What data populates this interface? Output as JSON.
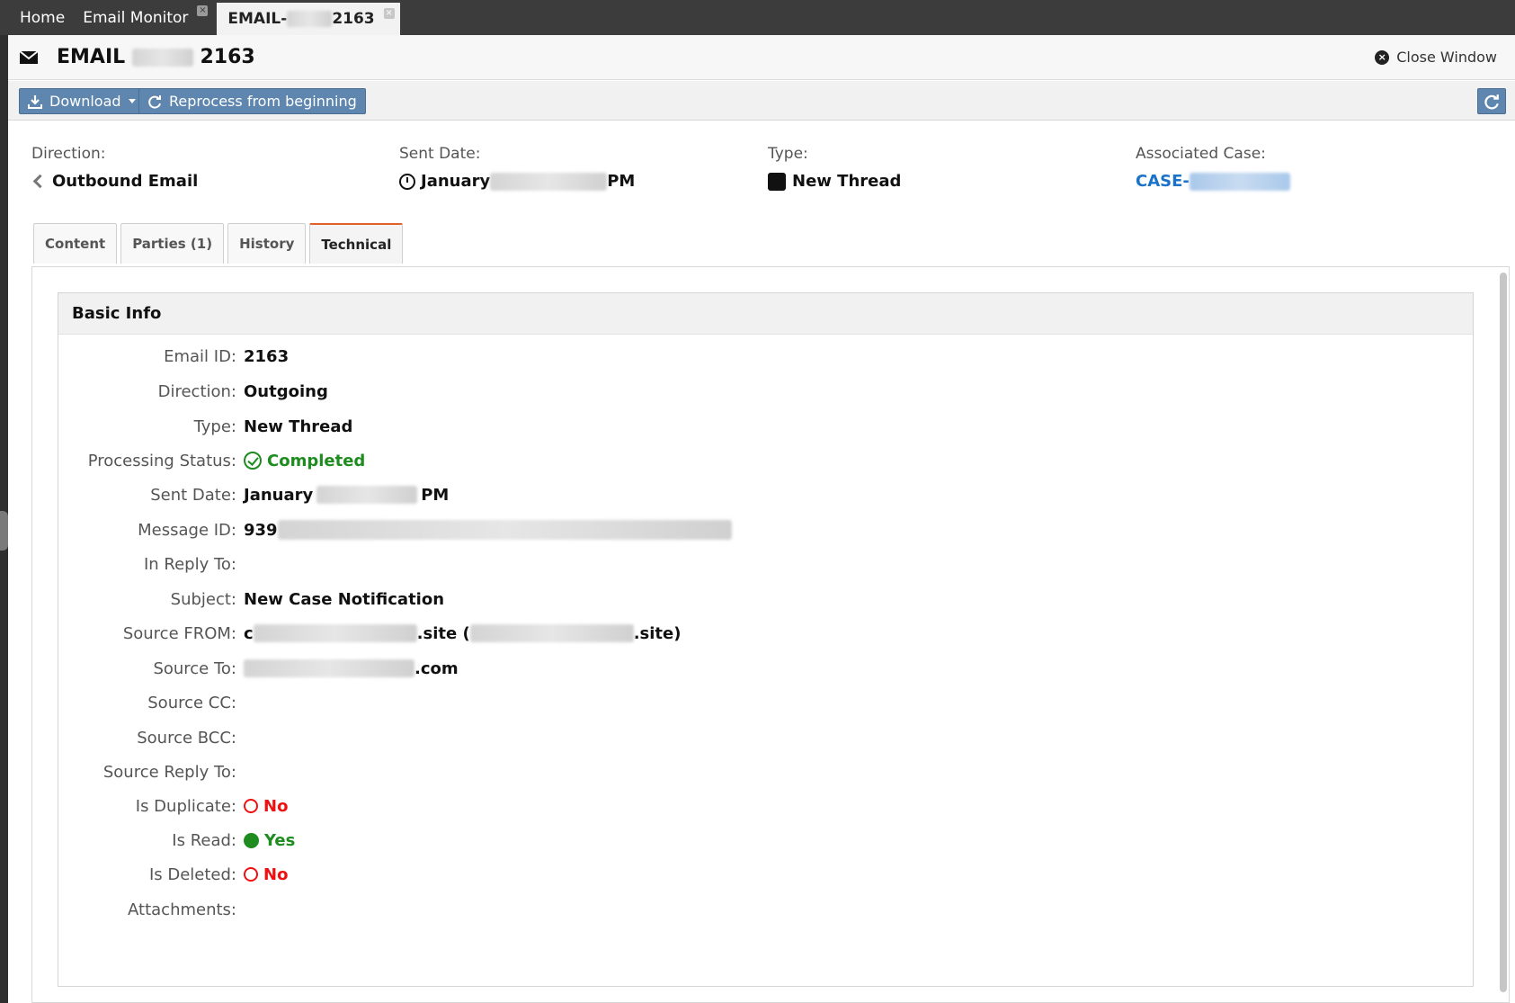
{
  "tabs_bar": {
    "home": "Home",
    "email_monitor": "Email Monitor",
    "email_tab_prefix": "EMAIL-",
    "email_tab_suffix": "2163",
    "close_glyph": "×"
  },
  "window": {
    "title_prefix": "EMAIL",
    "title_suffix": "2163",
    "close_label": "Close Window",
    "close_glyph": "×"
  },
  "toolbar": {
    "download_label": "Download",
    "reprocess_label": "Reprocess from beginning",
    "download_icon": "download-icon",
    "refresh_icon": "refresh-icon"
  },
  "summary": {
    "direction_label": "Direction:",
    "direction_value": "Outbound Email",
    "sent_label": "Sent Date:",
    "sent_prefix": "January",
    "sent_suffix": "PM",
    "type_label": "Type:",
    "type_value": "New Thread",
    "case_label": "Associated Case:",
    "case_prefix": "CASE-"
  },
  "content_tabs": [
    "Content",
    "Parties (1)",
    "History",
    "Technical"
  ],
  "basic_info": {
    "heading": "Basic Info",
    "email_id_label": "Email ID:",
    "email_id": "2163",
    "direction_label": "Direction:",
    "direction": "Outgoing",
    "type_label": "Type:",
    "type": "New Thread",
    "status_label": "Processing Status:",
    "status": "Completed",
    "sent_label": "Sent Date:",
    "sent_prefix": "January",
    "sent_suffix": "PM",
    "message_id_label": "Message ID:",
    "message_id_prefix": "939",
    "in_reply_label": "In Reply To:",
    "subject_label": "Subject:",
    "subject": "New Case Notification",
    "from_label": "Source FROM:",
    "from_start": "c",
    "from_mid": ".site (",
    "from_end": ".site)",
    "to_label": "Source To:",
    "to_end": ".com",
    "cc_label": "Source CC:",
    "bcc_label": "Source BCC:",
    "reply_to_label": "Source Reply To:",
    "duplicate_label": "Is Duplicate:",
    "duplicate": "No",
    "read_label": "Is Read:",
    "read": "Yes",
    "deleted_label": "Is Deleted:",
    "deleted": "No",
    "attachments_label": "Attachments:"
  },
  "colors": {
    "accent_button": "#5e86ae",
    "success": "#1e8c1e",
    "error": "#ee1111",
    "link": "#1a73c8",
    "active_tab_border": "#e0622a"
  }
}
